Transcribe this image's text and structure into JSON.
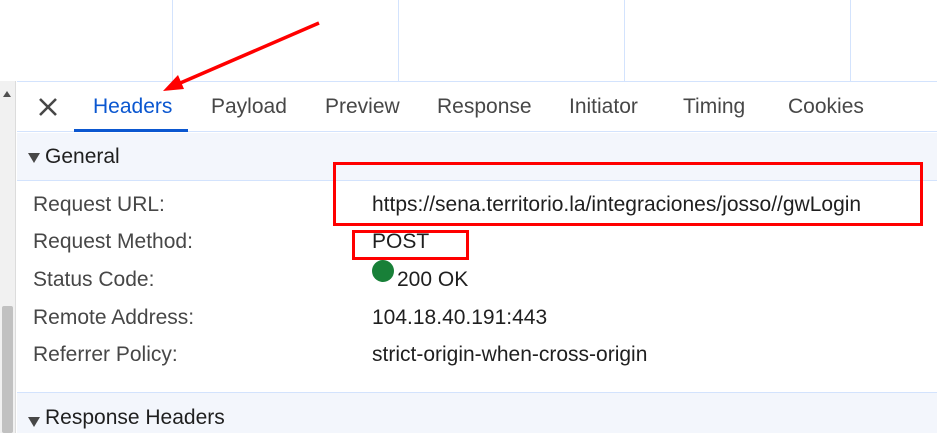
{
  "tabs": [
    {
      "label": "Headers",
      "active": true
    },
    {
      "label": "Payload",
      "active": false
    },
    {
      "label": "Preview",
      "active": false
    },
    {
      "label": "Response",
      "active": false
    },
    {
      "label": "Initiator",
      "active": false
    },
    {
      "label": "Timing",
      "active": false
    },
    {
      "label": "Cookies",
      "active": false
    }
  ],
  "general": {
    "title": "General",
    "rows": [
      {
        "key": "Request URL:",
        "value": "https://sena.territorio.la/integraciones/josso//gwLogin"
      },
      {
        "key": "Request Method:",
        "value": "POST"
      },
      {
        "key": "Status Code:",
        "value": "200 OK"
      },
      {
        "key": "Remote Address:",
        "value": "104.18.40.191:443"
      },
      {
        "key": "Referrer Policy:",
        "value": "strict-origin-when-cross-origin"
      }
    ]
  },
  "response_headers": {
    "title": "Response Headers"
  },
  "colors": {
    "accent": "#0b57d0",
    "status_ok": "#188038",
    "annotation": "#ff0000",
    "section_bg": "#f3f6fc"
  },
  "icons": {
    "close": "close-icon",
    "expand": "triangle-down-icon",
    "status": "status-dot-icon"
  }
}
